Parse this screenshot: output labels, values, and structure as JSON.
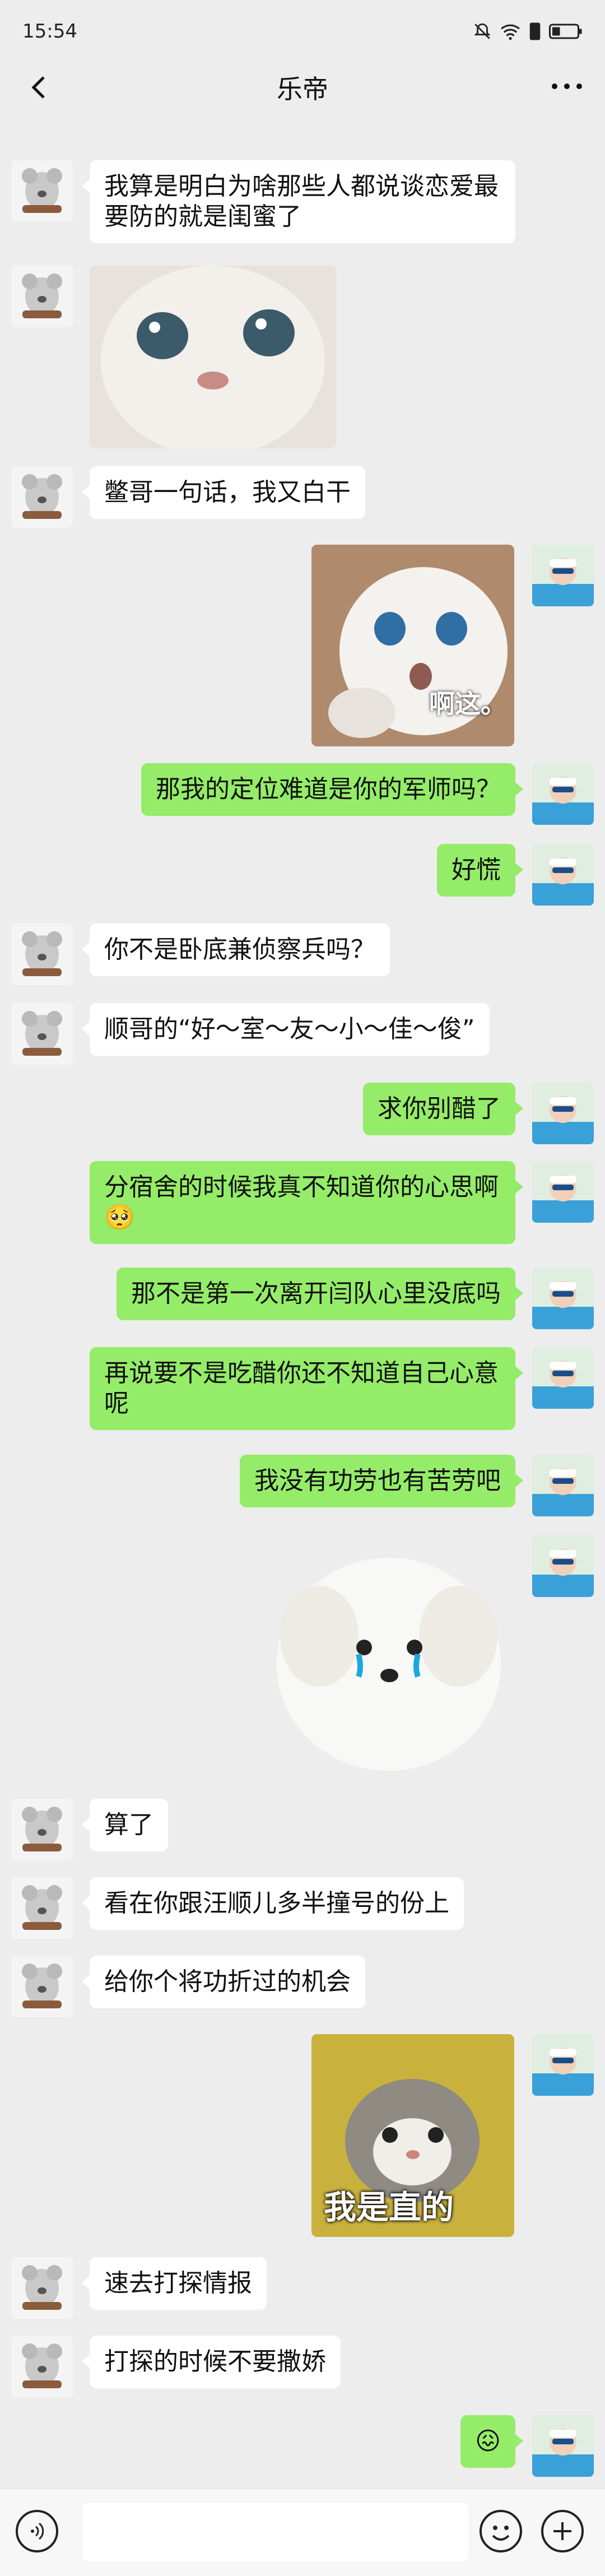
{
  "status": {
    "time": "15:54",
    "battery": "battery-icon",
    "wifi": "wifi-icon",
    "mute": "mute-icon"
  },
  "header": {
    "title": "乐帝",
    "back_icon": "back-icon",
    "more_icon": "more-icon"
  },
  "messages": [
    {
      "side": "left",
      "kind": "text",
      "text": "我算是明白为啥那些人都说谈恋爱最要防的就是闺蜜了"
    },
    {
      "side": "left",
      "kind": "sticker",
      "text": ""
    },
    {
      "side": "left",
      "kind": "text",
      "text": "鳖哥一句话，我又白干"
    },
    {
      "side": "right",
      "kind": "sticker",
      "text": "啊这。"
    },
    {
      "side": "right",
      "kind": "text",
      "text": "那我的定位难道是你的军师吗？"
    },
    {
      "side": "right",
      "kind": "text",
      "text": "好慌"
    },
    {
      "side": "left",
      "kind": "text",
      "text": "你不是卧底兼侦察兵吗？"
    },
    {
      "side": "left",
      "kind": "text",
      "text": "顺哥的“好～室～友～小～佳～俊”"
    },
    {
      "side": "right",
      "kind": "text",
      "text": "求你别醋了"
    },
    {
      "side": "right",
      "kind": "text",
      "text": "分宿舍的时候我真不知道你的心思啊🥺"
    },
    {
      "side": "right",
      "kind": "text",
      "text": "那不是第一次离开闫队心里没底吗"
    },
    {
      "side": "right",
      "kind": "text",
      "text": "再说要不是吃醋你还不知道自己心意呢"
    },
    {
      "side": "right",
      "kind": "text",
      "text": "我没有功劳也有苦劳吧"
    },
    {
      "side": "right",
      "kind": "sticker",
      "text": ""
    },
    {
      "side": "left",
      "kind": "text",
      "text": "算了"
    },
    {
      "side": "left",
      "kind": "text",
      "text": "看在你跟汪顺儿多半撞号的份上"
    },
    {
      "side": "left",
      "kind": "text",
      "text": "给你个将功折过的机会"
    },
    {
      "side": "right",
      "kind": "sticker",
      "text": "我是直的"
    },
    {
      "side": "left",
      "kind": "text",
      "text": "速去打探情报"
    },
    {
      "side": "left",
      "kind": "text",
      "text": "打探的时候不要撒娇"
    },
    {
      "side": "right",
      "kind": "text",
      "text": "😖"
    }
  ],
  "input_bar": {
    "voice_icon": "voice-icon",
    "emoji_icon": "emoji-icon",
    "plus_icon": "plus-icon"
  }
}
